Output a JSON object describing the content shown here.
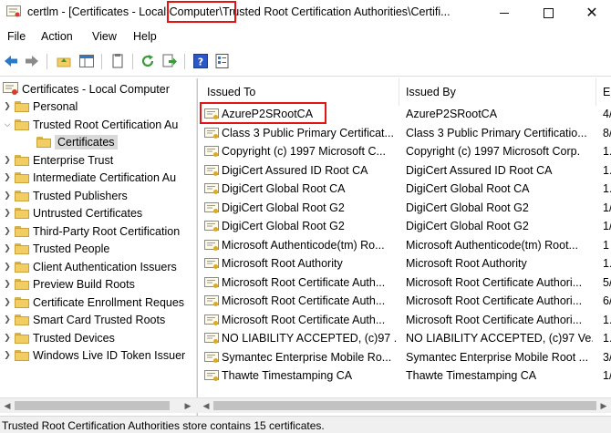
{
  "window": {
    "title": "certlm - [Certificates - Local Computer\\Trusted Root Certification Authorities\\Certifi..."
  },
  "menu": [
    "File",
    "Action",
    "View",
    "Help"
  ],
  "toolbar_icons": [
    "back-icon",
    "forward-icon",
    "up-folder-icon",
    "show-hide-tree-icon",
    "copy-icon",
    "refresh-icon",
    "export-list-icon",
    "help-icon",
    "properties-icon"
  ],
  "tree": {
    "root": "Certificates - Local Computer",
    "items": [
      {
        "label": "Personal",
        "expanded": false
      },
      {
        "label": "Trusted Root Certification Au",
        "expanded": true
      },
      {
        "label": "Certificates",
        "selected": true
      },
      {
        "label": "Enterprise Trust",
        "expanded": false
      },
      {
        "label": "Intermediate Certification Au",
        "expanded": false
      },
      {
        "label": "Trusted Publishers",
        "expanded": false
      },
      {
        "label": "Untrusted Certificates",
        "expanded": false
      },
      {
        "label": "Third-Party Root Certification",
        "expanded": false
      },
      {
        "label": "Trusted People",
        "expanded": false
      },
      {
        "label": "Client Authentication Issuers",
        "expanded": false
      },
      {
        "label": "Preview Build Roots",
        "expanded": false
      },
      {
        "label": "Certificate Enrollment Reques",
        "expanded": false
      },
      {
        "label": "Smart Card Trusted Roots",
        "expanded": false
      },
      {
        "label": "Trusted Devices",
        "expanded": false
      },
      {
        "label": "Windows Live ID Token Issuer",
        "expanded": false
      }
    ]
  },
  "list": {
    "columns": [
      "Issued To",
      "Issued By",
      "E"
    ],
    "rows": [
      {
        "issued_to": "AzureP2SRootCA",
        "issued_by": "AzureP2SRootCA",
        "exp": "4/"
      },
      {
        "issued_to": "Class 3 Public Primary Certificat...",
        "issued_by": "Class 3 Public Primary Certificatio...",
        "exp": "8/"
      },
      {
        "issued_to": "Copyright (c) 1997 Microsoft C...",
        "issued_by": "Copyright (c) 1997 Microsoft Corp.",
        "exp": "1."
      },
      {
        "issued_to": "DigiCert Assured ID Root CA",
        "issued_by": "DigiCert Assured ID Root CA",
        "exp": "1."
      },
      {
        "issued_to": "DigiCert Global Root CA",
        "issued_by": "DigiCert Global Root CA",
        "exp": "1."
      },
      {
        "issued_to": "DigiCert Global Root G2",
        "issued_by": "DigiCert Global Root G2",
        "exp": "1/"
      },
      {
        "issued_to": "DigiCert Global Root G2",
        "issued_by": "DigiCert Global Root G2",
        "exp": "1/"
      },
      {
        "issued_to": "Microsoft Authenticode(tm) Ro...",
        "issued_by": "Microsoft Authenticode(tm) Root...",
        "exp": "1"
      },
      {
        "issued_to": "Microsoft Root Authority",
        "issued_by": "Microsoft Root Authority",
        "exp": "1."
      },
      {
        "issued_to": "Microsoft Root Certificate Auth...",
        "issued_by": "Microsoft Root Certificate Authori...",
        "exp": "5/"
      },
      {
        "issued_to": "Microsoft Root Certificate Auth...",
        "issued_by": "Microsoft Root Certificate Authori...",
        "exp": "6/"
      },
      {
        "issued_to": "Microsoft Root Certificate Auth...",
        "issued_by": "Microsoft Root Certificate Authori...",
        "exp": "1."
      },
      {
        "issued_to": "NO LIABILITY ACCEPTED, (c)97 ...",
        "issued_by": "NO LIABILITY ACCEPTED, (c)97 Ve...",
        "exp": "1."
      },
      {
        "issued_to": "Symantec Enterprise Mobile Ro...",
        "issued_by": "Symantec Enterprise Mobile Root ...",
        "exp": "3/"
      },
      {
        "issued_to": "Thawte Timestamping CA",
        "issued_by": "Thawte Timestamping CA",
        "exp": "1/"
      }
    ]
  },
  "status": "Trusted Root Certification Authorities store contains 15 certificates.",
  "colors": {
    "highlight": "#e41414",
    "folder": "#f2cd62",
    "toolbar_blue": "#2a78c8",
    "toolbar_green": "#3c9a3c"
  }
}
